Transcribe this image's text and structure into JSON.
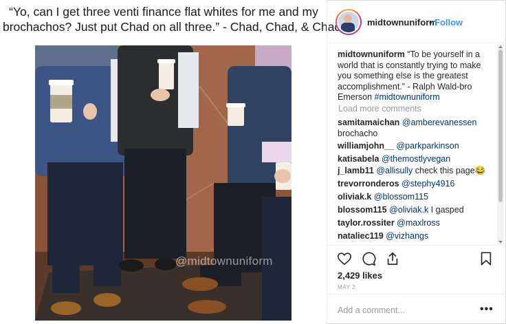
{
  "meme": {
    "caption_line1": "“Yo, can I get three venti finance flat whites for me and my",
    "caption_line2": "brochachos? Just put Chad on all three.” - Chad, Chad, & Chad",
    "watermark": "@midtownuniform"
  },
  "post": {
    "username": "midtownuniform",
    "separator": "•",
    "follow_label": "Follow",
    "caption_user": "midtownuniform",
    "caption_text": "“To be yourself in a world that is constantly trying to make you something else is the greatest accomplishment.” - Ralph Wald-bro Emerson",
    "caption_hashtag": "#midtownuniform",
    "load_more": "Load more comments",
    "comments": [
      {
        "user": "samitamaichan",
        "mention": "@amberevanessen",
        "text": "",
        "line2": "brochacho"
      },
      {
        "user": "williamjohn__",
        "mention": "@parkparkinson",
        "text": ""
      },
      {
        "user": "katisabela",
        "mention": "@themostlyvegan",
        "text": ""
      },
      {
        "user": "j_lamb11",
        "mention": "@allisully",
        "text": "check this page😂"
      },
      {
        "user": "trevorronderos",
        "mention": "@stephy4916",
        "text": ""
      },
      {
        "user": "oliviak.k",
        "mention": "@blossom115",
        "text": ""
      },
      {
        "user": "blossom115",
        "mention": "@oliviak.k",
        "text": "I gasped"
      },
      {
        "user": "taylor.rossiter",
        "mention": "@maxlross",
        "text": ""
      },
      {
        "user": "nataliec119",
        "mention": "@vizhangs",
        "text": ""
      }
    ],
    "likes": "2,429 likes",
    "date": "MAY 2",
    "comment_placeholder": "Add a comment...",
    "more_label": "•••"
  },
  "colors": {
    "link": "#3897f0",
    "mention": "#003569",
    "muted": "#999999",
    "text": "#262626"
  },
  "icons": [
    "heart-icon",
    "comment-icon",
    "share-icon",
    "bookmark-icon",
    "more-options-icon"
  ]
}
